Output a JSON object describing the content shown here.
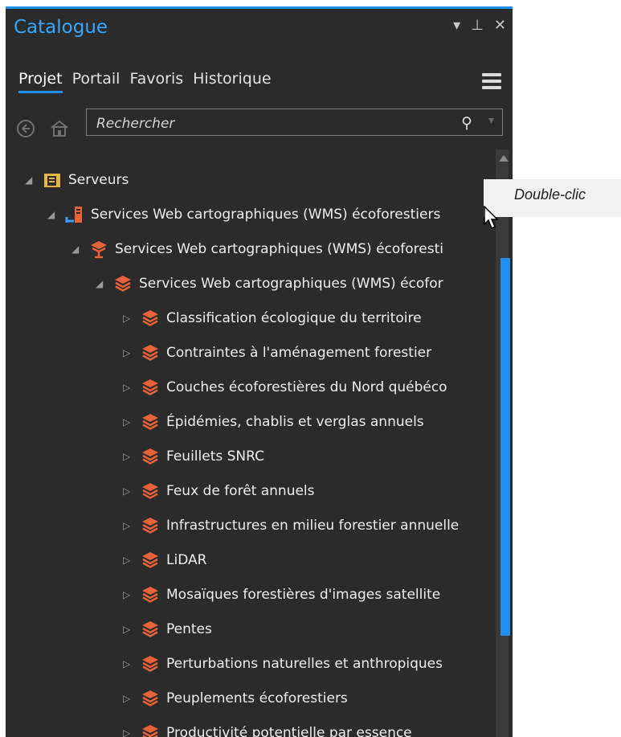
{
  "panel": {
    "title": "Catalogue",
    "controls": {
      "dropdown": "▾",
      "pin": "⊥",
      "close": "✕"
    }
  },
  "tabs": [
    {
      "label": "Projet",
      "active": true
    },
    {
      "label": "Portail"
    },
    {
      "label": "Favoris"
    },
    {
      "label": "Historique"
    }
  ],
  "search": {
    "placeholder": "Rechercher"
  },
  "tree": {
    "root": "Serveurs",
    "level1": "Services Web cartographiques (WMS) écoforestiers",
    "level2": "Services Web cartographiques (WMS) écoforesti",
    "level3": "Services Web cartographiques (WMS) écofor",
    "layers": [
      "Classification écologique du territoire",
      "Contraintes à l'aménagement forestier",
      "Couches écoforestières du Nord québéco",
      "Épidémies, chablis et verglas annuels",
      "Feuillets SNRC",
      "Feux de forêt annuels",
      "Infrastructures en milieu forestier annuelle",
      "LiDAR",
      "Mosaïques forestières d'images satellite",
      "Pentes",
      "Perturbations naturelles et anthropiques",
      "Peuplements écoforestiers",
      "Productivité potentielle par essence"
    ]
  },
  "annotation": {
    "label": "Double-clic"
  },
  "colors": {
    "accent": "#1f8ff0",
    "panel_bg": "#2b2b2b",
    "layer_icon": "#e8623a"
  }
}
